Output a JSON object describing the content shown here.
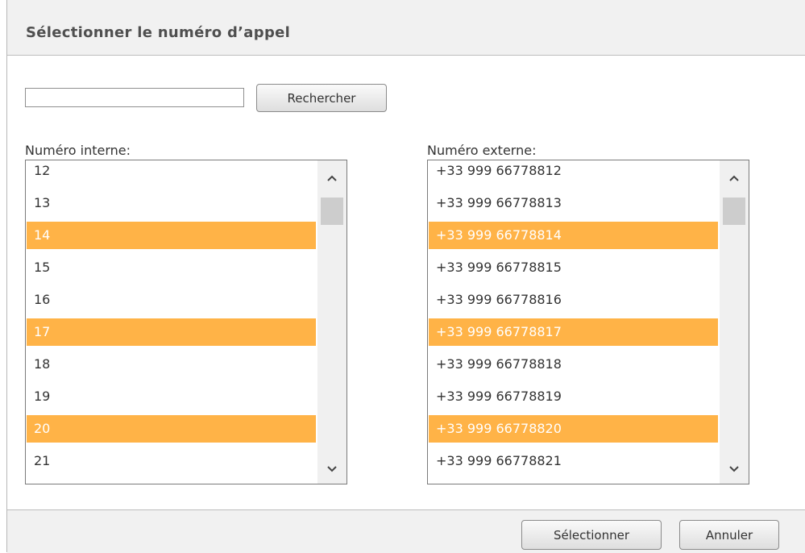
{
  "dialog": {
    "title": "Sélectionner le numéro d’appel"
  },
  "search": {
    "value": "",
    "button_label": "Rechercher"
  },
  "internal": {
    "label": "Numéro interne:",
    "rows": [
      {
        "text": "12",
        "selected": false
      },
      {
        "text": "13",
        "selected": false
      },
      {
        "text": "14",
        "selected": true
      },
      {
        "text": "15",
        "selected": false
      },
      {
        "text": "16",
        "selected": false
      },
      {
        "text": "17",
        "selected": true
      },
      {
        "text": "18",
        "selected": false
      },
      {
        "text": "19",
        "selected": false
      },
      {
        "text": "20",
        "selected": true
      },
      {
        "text": "21",
        "selected": false
      }
    ]
  },
  "external": {
    "label": "Numéro externe:",
    "rows": [
      {
        "text": "+33 999 66778812",
        "selected": false
      },
      {
        "text": "+33 999 66778813",
        "selected": false
      },
      {
        "text": "+33 999 66778814",
        "selected": true
      },
      {
        "text": "+33 999 66778815",
        "selected": false
      },
      {
        "text": "+33 999 66778816",
        "selected": false
      },
      {
        "text": "+33 999 66778817",
        "selected": true
      },
      {
        "text": "+33 999 66778818",
        "selected": false
      },
      {
        "text": "+33 999 66778819",
        "selected": false
      },
      {
        "text": "+33 999 66778820",
        "selected": true
      },
      {
        "text": "+33 999 66778821",
        "selected": false
      }
    ]
  },
  "footer": {
    "select_label": "Sélectionner",
    "cancel_label": "Annuler"
  },
  "colors": {
    "selected_row": "#ffb347",
    "header_bg": "#f1f1f1"
  },
  "icons": {
    "scroll_up": "chevron-up-icon",
    "scroll_down": "chevron-down-icon"
  }
}
